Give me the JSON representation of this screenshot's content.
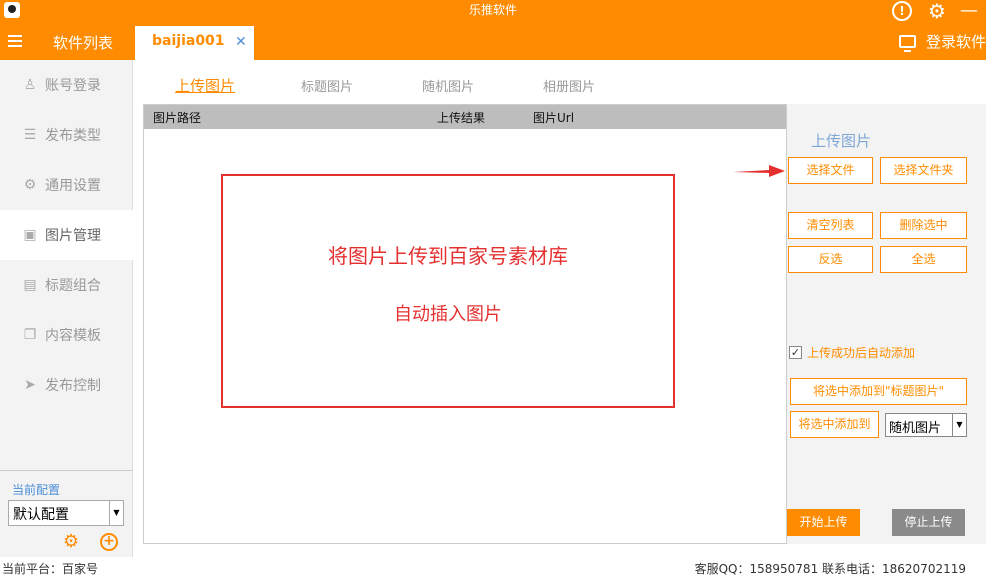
{
  "window": {
    "title": "乐推软件"
  },
  "nav": {
    "title": "软件列表",
    "active_tab": "baijia001",
    "tab_close": "✕",
    "login": "登录软件"
  },
  "sidebar": {
    "items": [
      {
        "label": "账号登录",
        "icon": "user-icon"
      },
      {
        "label": "发布类型",
        "icon": "list-icon"
      },
      {
        "label": "通用设置",
        "icon": "gear-icon"
      },
      {
        "label": "图片管理",
        "icon": "image-icon"
      },
      {
        "label": "标题组合",
        "icon": "document-icon"
      },
      {
        "label": "内容模板",
        "icon": "copy-icon"
      },
      {
        "label": "发布控制",
        "icon": "send-icon"
      }
    ],
    "active_index": 3,
    "config_label": "当前配置",
    "config_value": "默认配置"
  },
  "subtabs": [
    "上传图片",
    "标题图片",
    "随机图片",
    "相册图片"
  ],
  "table": {
    "columns": [
      "图片路径",
      "上传结果",
      "图片Url"
    ]
  },
  "annotation": {
    "line1": "将图片上传到百家号素材库",
    "line2": "自动插入图片"
  },
  "panel": {
    "title": "上传图片",
    "choose_file": "选择文件",
    "choose_folder": "选择文件夹",
    "clear_list": "清空列表",
    "delete_selected": "删除选中",
    "invert": "反选",
    "select_all": "全选",
    "auto_add_label": "上传成功后自动添加",
    "auto_add_checked": true,
    "add_to_title": "将选中添加到\"标题图片\"",
    "add_to": "将选中添加到",
    "target_select": "随机图片",
    "start": "开始上传",
    "stop": "停止上传"
  },
  "status": {
    "platform": "当前平台：百家号",
    "contact": "客服QQ：158950781   联系电话：18620702119"
  },
  "colors": {
    "accent": "#ff8c00",
    "annotation": "#e53030",
    "link": "#4a8ed8"
  }
}
